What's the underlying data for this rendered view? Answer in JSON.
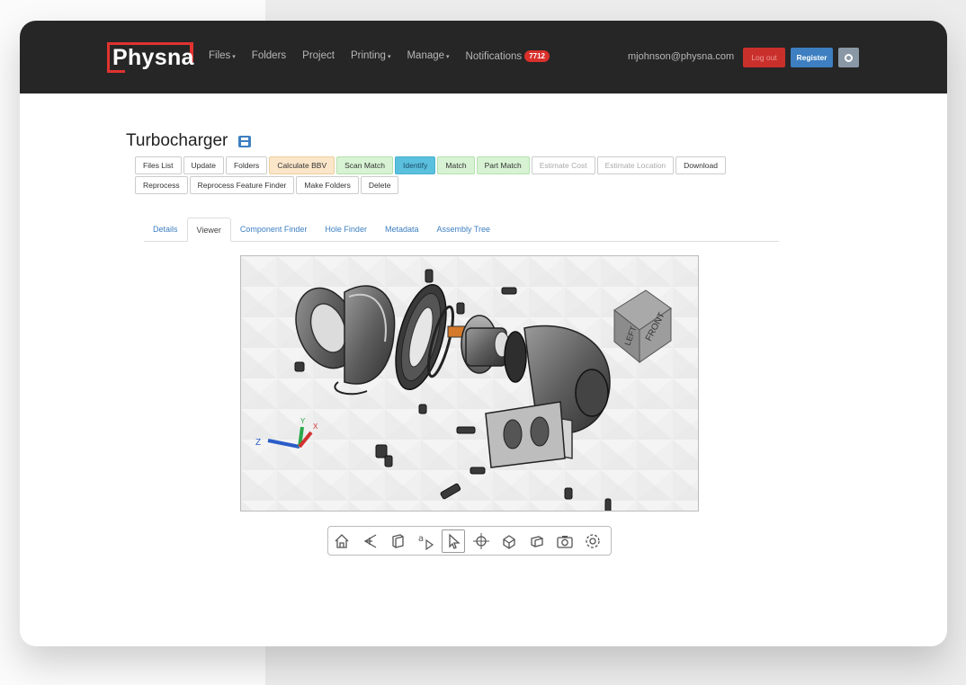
{
  "nav": {
    "logo": "Physna",
    "links": [
      "Files",
      "Folders",
      "Project",
      "Printing",
      "Manage",
      "Notifications"
    ],
    "link_suffixes": [
      "▾",
      "",
      "",
      "▾",
      "▾",
      ""
    ],
    "notifications_count": "7712",
    "user_email": "mjohnson@physna.com",
    "logout_label": "Log out",
    "register_label": "Register"
  },
  "page": {
    "title": "Turbocharger"
  },
  "toolbar": {
    "row1": [
      {
        "label": "Files List",
        "style": "default"
      },
      {
        "label": "Update",
        "style": "default"
      },
      {
        "label": "Folders",
        "style": "default"
      },
      {
        "label": "Calculate BBV",
        "style": "orange"
      },
      {
        "label": "Scan Match",
        "style": "green"
      },
      {
        "label": "Identify",
        "style": "blue"
      },
      {
        "label": "Match",
        "style": "green"
      },
      {
        "label": "Part Match",
        "style": "green"
      },
      {
        "label": "Estimate Cost",
        "style": "disabled"
      },
      {
        "label": "Estimate Location",
        "style": "disabled"
      },
      {
        "label": "Download",
        "style": "default"
      }
    ],
    "row2": [
      {
        "label": "Reprocess",
        "style": "default"
      },
      {
        "label": "Reprocess Feature Finder",
        "style": "default"
      },
      {
        "label": "Make Folders",
        "style": "default"
      },
      {
        "label": "Delete",
        "style": "default"
      }
    ]
  },
  "tabs": [
    {
      "label": "Details",
      "active": false
    },
    {
      "label": "Viewer",
      "active": true
    },
    {
      "label": "Component Finder",
      "active": false
    },
    {
      "label": "Hole Finder",
      "active": false
    },
    {
      "label": "Metadata",
      "active": false
    },
    {
      "label": "Assembly Tree",
      "active": false
    }
  ],
  "viewer": {
    "cube_faces": [
      "FRONT",
      "LEFT"
    ],
    "axis_labels": [
      "Z",
      "Y",
      "X"
    ],
    "tools": [
      "home-icon",
      "explode-icon",
      "box-view-icon",
      "annotation-icon",
      "select-icon",
      "move-icon",
      "model-icon",
      "section-icon",
      "camera-icon",
      "settings-icon"
    ],
    "active_tool": "select-icon"
  },
  "colors": {
    "navbar": "#262626",
    "brand_red": "#e0332f",
    "link_blue": "#3d7fc1"
  }
}
